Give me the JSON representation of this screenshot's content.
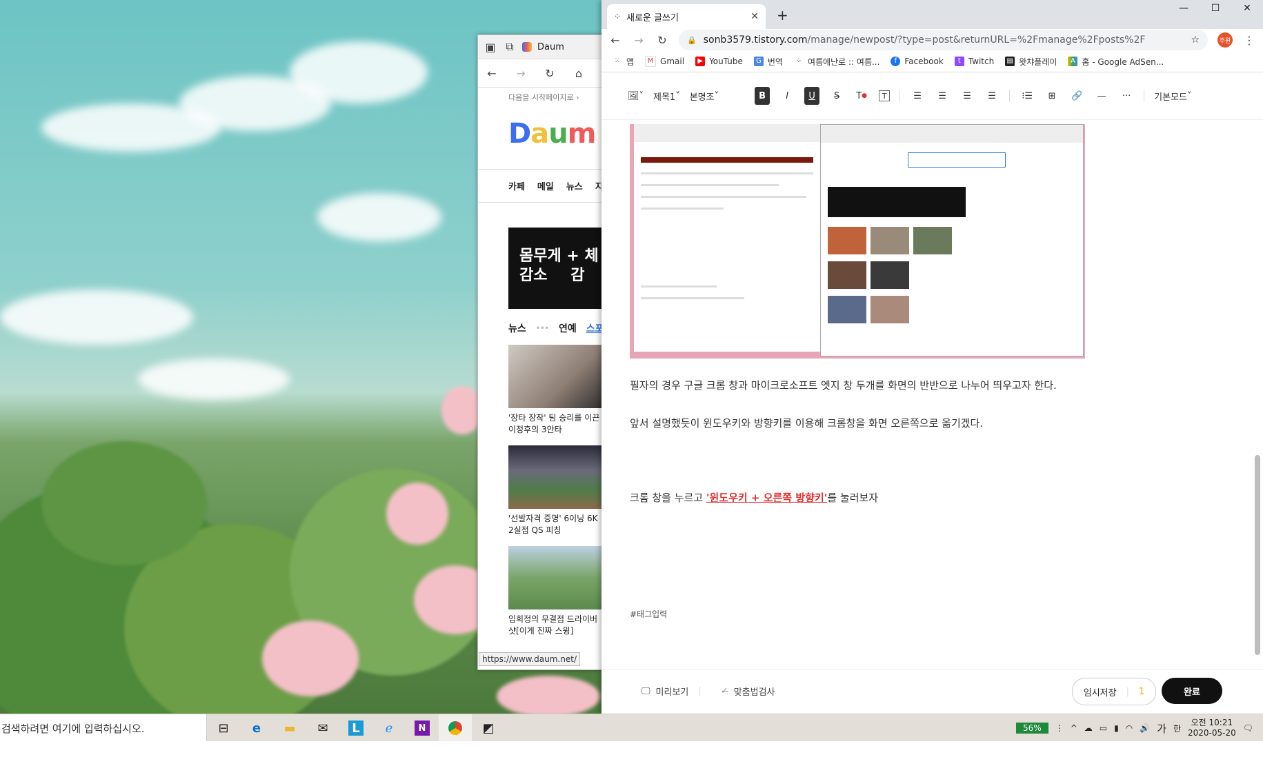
{
  "taskbar": {
    "search_placeholder": "검색하려면 여기에 입력하십시오.",
    "battery": "56%",
    "ime": "가",
    "ime2": "한",
    "time": "오전 10:21",
    "date": "2020-05-20"
  },
  "daum": {
    "tab_title": "Daum",
    "start_page": "다음을 시작페이지로 ›",
    "logo": "Daum",
    "nav": [
      "카페",
      "메일",
      "뉴스",
      "지"
    ],
    "ad_line1": "몸무게",
    "ad_line2": "감소",
    "ad_plus": "+ 체",
    "ad_plus2": "감",
    "news_tabs": [
      "뉴스",
      "연예",
      "스포츠"
    ],
    "news": [
      {
        "caption": "'장타 장착' 팀 승리를 이끈 이정후의 3안타"
      },
      {
        "caption": "'선발자격 증명' 6이닝 6K 2실점 QS 피칭"
      },
      {
        "caption": "임희정의 무결점 드라이버 샷[이게 진짜 스윙]"
      }
    ],
    "status_url": "https://www.daum.net/"
  },
  "chrome": {
    "tab_title": "새로운 글쓰기",
    "url_host": "sonb3579.tistory.com",
    "url_path": "/manage/newpost/?type=post&returnURL=%2Fmanage%2Fposts%2F",
    "profile": "주원",
    "bookmarks": [
      "앱",
      "Gmail",
      "YouTube",
      "번역",
      "여름에난로 :: 여름...",
      "Facebook",
      "Twitch",
      "왓챠플레이",
      "홈 - Google AdSen..."
    ]
  },
  "editor": {
    "heading": "제목1",
    "font": "본명조",
    "mode": "기본모드",
    "para1": "필자의 경우 구글 크롬 창과 마이크로소프트 엣지 창 두개를 화면의 반반으로 나누어 띄우고자 한다.",
    "para2": "앞서 설명했듯이 윈도우키와 방향키를 이용해 크롬창을 화면 오른쪽으로 옮기겠다.",
    "para3_pre": "크롬 창을 누르고 ",
    "para3_hl": "'윈도우키 + 오른쪽 방향키'",
    "para3_post": "를 눌러보자",
    "tags": "#태그입력",
    "preview": "미리보기",
    "spell": "맞춤법검사",
    "save": "임시저장",
    "save_count": "1",
    "done": "완료"
  }
}
